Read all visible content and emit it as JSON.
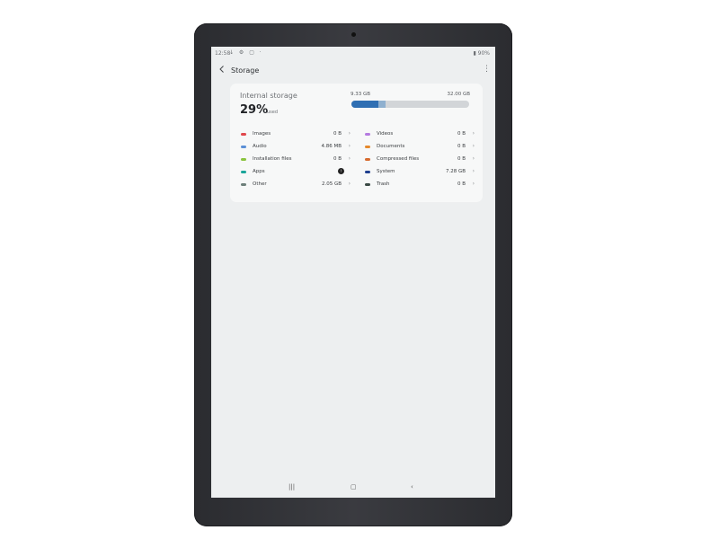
{
  "status_bar": {
    "time": "12:58",
    "battery": "90%"
  },
  "app_bar": {
    "title": "Storage"
  },
  "storage": {
    "title": "Internal storage",
    "percent": "29%",
    "used_label": "used",
    "used_gb": "9.33 GB",
    "total_gb": "32.00 GB",
    "used_fraction": 0.29
  },
  "categories_left": [
    {
      "label": "Images",
      "size": "0 B",
      "color": "#e0474c"
    },
    {
      "label": "Audio",
      "size": "4.86 MB",
      "color": "#5b8fd6"
    },
    {
      "label": "Installation files",
      "size": "0 B",
      "color": "#8ac43f"
    },
    {
      "label": "Apps",
      "size": "",
      "color": "#1aa59a"
    },
    {
      "label": "Other",
      "size": "2.05 GB",
      "color": "#6d7f7a"
    }
  ],
  "categories_right": [
    {
      "label": "Videos",
      "size": "0 B",
      "color": "#b47ae0"
    },
    {
      "label": "Documents",
      "size": "0 B",
      "color": "#e5892c"
    },
    {
      "label": "Compressed files",
      "size": "0 B",
      "color": "#d76b2f"
    },
    {
      "label": "System",
      "size": "7.28 GB",
      "color": "#1f3f8f"
    },
    {
      "label": "Trash",
      "size": "0 B",
      "color": "#3b4a45"
    }
  ],
  "icons": {
    "back": "back-arrow-icon",
    "more": "more-vertical-icon",
    "chevron": "chevron-right-icon",
    "nav_recents": "recents-icon",
    "nav_home": "home-icon",
    "nav_back": "nav-back-icon"
  }
}
